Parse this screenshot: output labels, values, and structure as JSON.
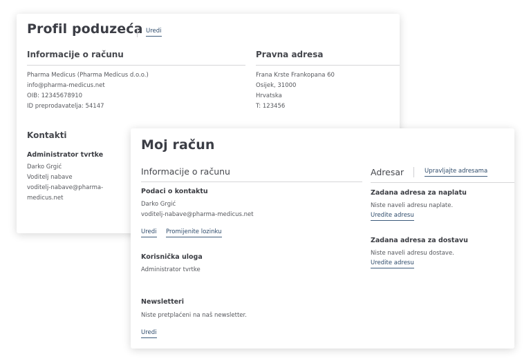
{
  "company_profile": {
    "title": "Profil poduzeća",
    "edit_label": "Uredi",
    "account_info": {
      "heading": "Informacije o računu",
      "lines": [
        "Pharma Medicus (Pharma Medicus d.o.o.)",
        "info@pharma-medicus.net",
        "OIB: 12345678910",
        "ID preprodavatelja: 54147"
      ]
    },
    "legal_address": {
      "heading": "Pravna adresa",
      "lines": [
        "Frana Krste Frankopana 60",
        "Osijek, 31000",
        "Hrvatska",
        "T: 123456"
      ]
    },
    "contacts": {
      "heading": "Kontakti",
      "admin_heading": "Administrator tvrtke",
      "lines": [
        "Darko Grgić",
        "Voditelj nabave",
        "voditelj-nabave@pharma-",
        "medicus.net"
      ]
    }
  },
  "my_account": {
    "title": "Moj račun",
    "account_info": {
      "heading": "Informacije o računu",
      "contact_heading": "Podaci o kontaktu",
      "contact_lines": [
        "Darko Grgić",
        "voditelj-nabave@pharma-medicus.net"
      ],
      "edit_label": "Uredi",
      "change_password_label": "Promijenite lozinku",
      "role_heading": "Korisnička uloga",
      "role_value": "Administrator tvrtke",
      "newsletter_heading": "Newsletteri",
      "newsletter_text": "Niste pretplaćeni na naš newsletter.",
      "newsletter_edit_label": "Uredi"
    },
    "address_book": {
      "heading": "Adresar",
      "manage_label": "Upravljajte adresama",
      "billing_heading": "Zadana adresa za naplatu",
      "billing_text": "Niste naveli adresu naplate.",
      "billing_edit_label": "Uredite adresu",
      "shipping_heading": "Zadana adresa za dostavu",
      "shipping_text": "Niste naveli adresu dostave.",
      "shipping_edit_label": "Uredite adresu"
    }
  }
}
